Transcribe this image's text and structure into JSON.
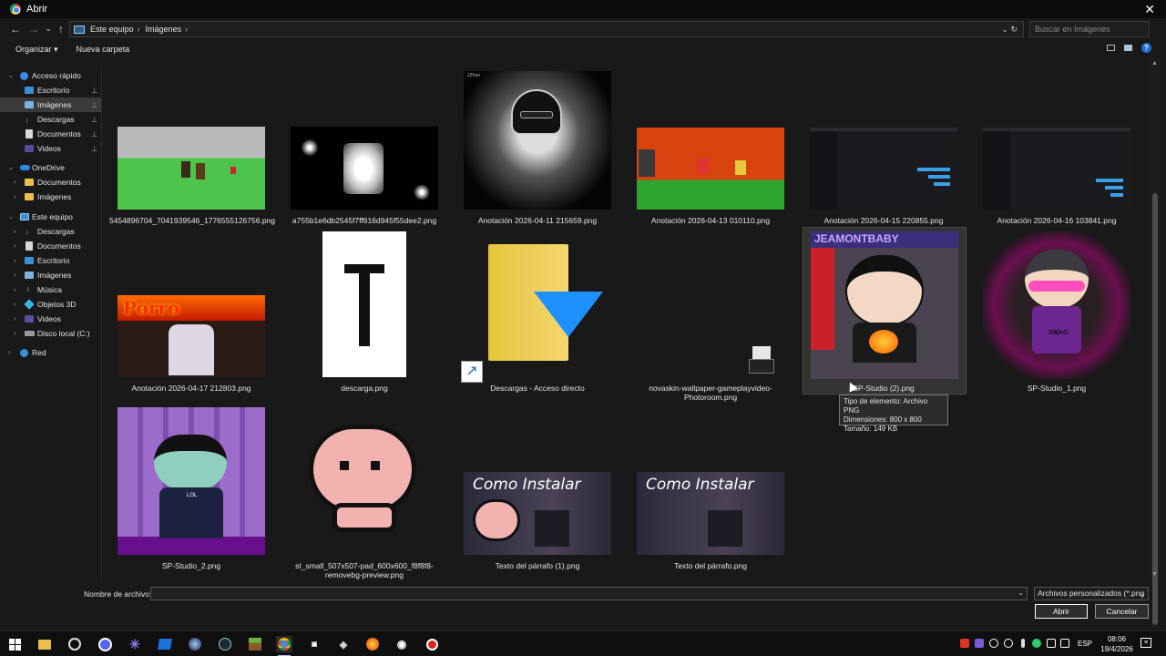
{
  "window": {
    "title": "Abrir",
    "close": "✕"
  },
  "nav_buttons": {
    "back": "←",
    "forward": "→",
    "dropdown": "⌄",
    "up": "↑"
  },
  "breadcrumb": [
    "Este equipo",
    "Imágenes"
  ],
  "breadcrumb_sep": "›",
  "path_controls": "⌄  ↻",
  "search": {
    "placeholder": "Buscar en Imágenes"
  },
  "commands": {
    "organize": "Organizar ▾",
    "new_folder": "Nueva carpeta"
  },
  "help": "?",
  "sidebar": {
    "quick_access": "Acceso rápido",
    "quick_items": [
      "Escritorio",
      "Imágenes",
      "Descargas",
      "Documentos",
      "Videos"
    ],
    "onedrive": "OneDrive",
    "onedrive_items": [
      "Documentos",
      "Imágenes"
    ],
    "this_pc": "Este equipo",
    "pc_items": [
      "Descargas",
      "Documentos",
      "Escritorio",
      "Imágenes",
      "Música",
      "Objetos 3D",
      "Videos",
      "Disco local (C:)"
    ],
    "network": "Red",
    "pin": "📌"
  },
  "files": [
    {
      "name": "5454896704_7041939546_1776555126756.png"
    },
    {
      "name": "a755b1e6db2545f7ff616d945f55dee2.png"
    },
    {
      "name": "Anotación 2026-04-11 215659.png",
      "small_text": "JZhao"
    },
    {
      "name": "Anotación 2026-04-13 010110.png"
    },
    {
      "name": "Anotación 2026-04-15 220855.png"
    },
    {
      "name": "Anotación 2026-04-16 103841.png"
    },
    {
      "name": "Anotación 2026-04-17 212803.png",
      "overlay": "Porro"
    },
    {
      "name": "descarga.png"
    },
    {
      "name": "Descargas - Acceso directo"
    },
    {
      "name": "novaskin-wallpaper-gameplayvideo-Photoroom.png"
    },
    {
      "name": "SP-Studio (2).png",
      "overlay": "JEAMONTBABY"
    },
    {
      "name": "SP-Studio_1.png",
      "overlay": "SWAG"
    },
    {
      "name": "SP-Studio_2.png",
      "overlay": "LOL"
    },
    {
      "name": "st_small_507x507-pad_600x600_f8f8f8-removebg-preview.png"
    },
    {
      "name": "Texto del párrafo (1).png",
      "overlay": "Como Instalar"
    },
    {
      "name": "Texto del párrafo.png",
      "overlay": "Como Instalar"
    }
  ],
  "tooltip": {
    "type": "Tipo de elemento: Archivo PNG",
    "dimensions": "Dimensiones: 800 x 800",
    "size": "Tamaño: 149 KB"
  },
  "bottom": {
    "filename_label": "Nombre de archivo:",
    "filename_value": "",
    "filter": "Archivos personalizados (*.png",
    "open": "Abrir",
    "cancel": "Cancelar"
  },
  "taskbar": {
    "lang": "ESP",
    "time": "08:06",
    "date": "19/4/2026"
  }
}
